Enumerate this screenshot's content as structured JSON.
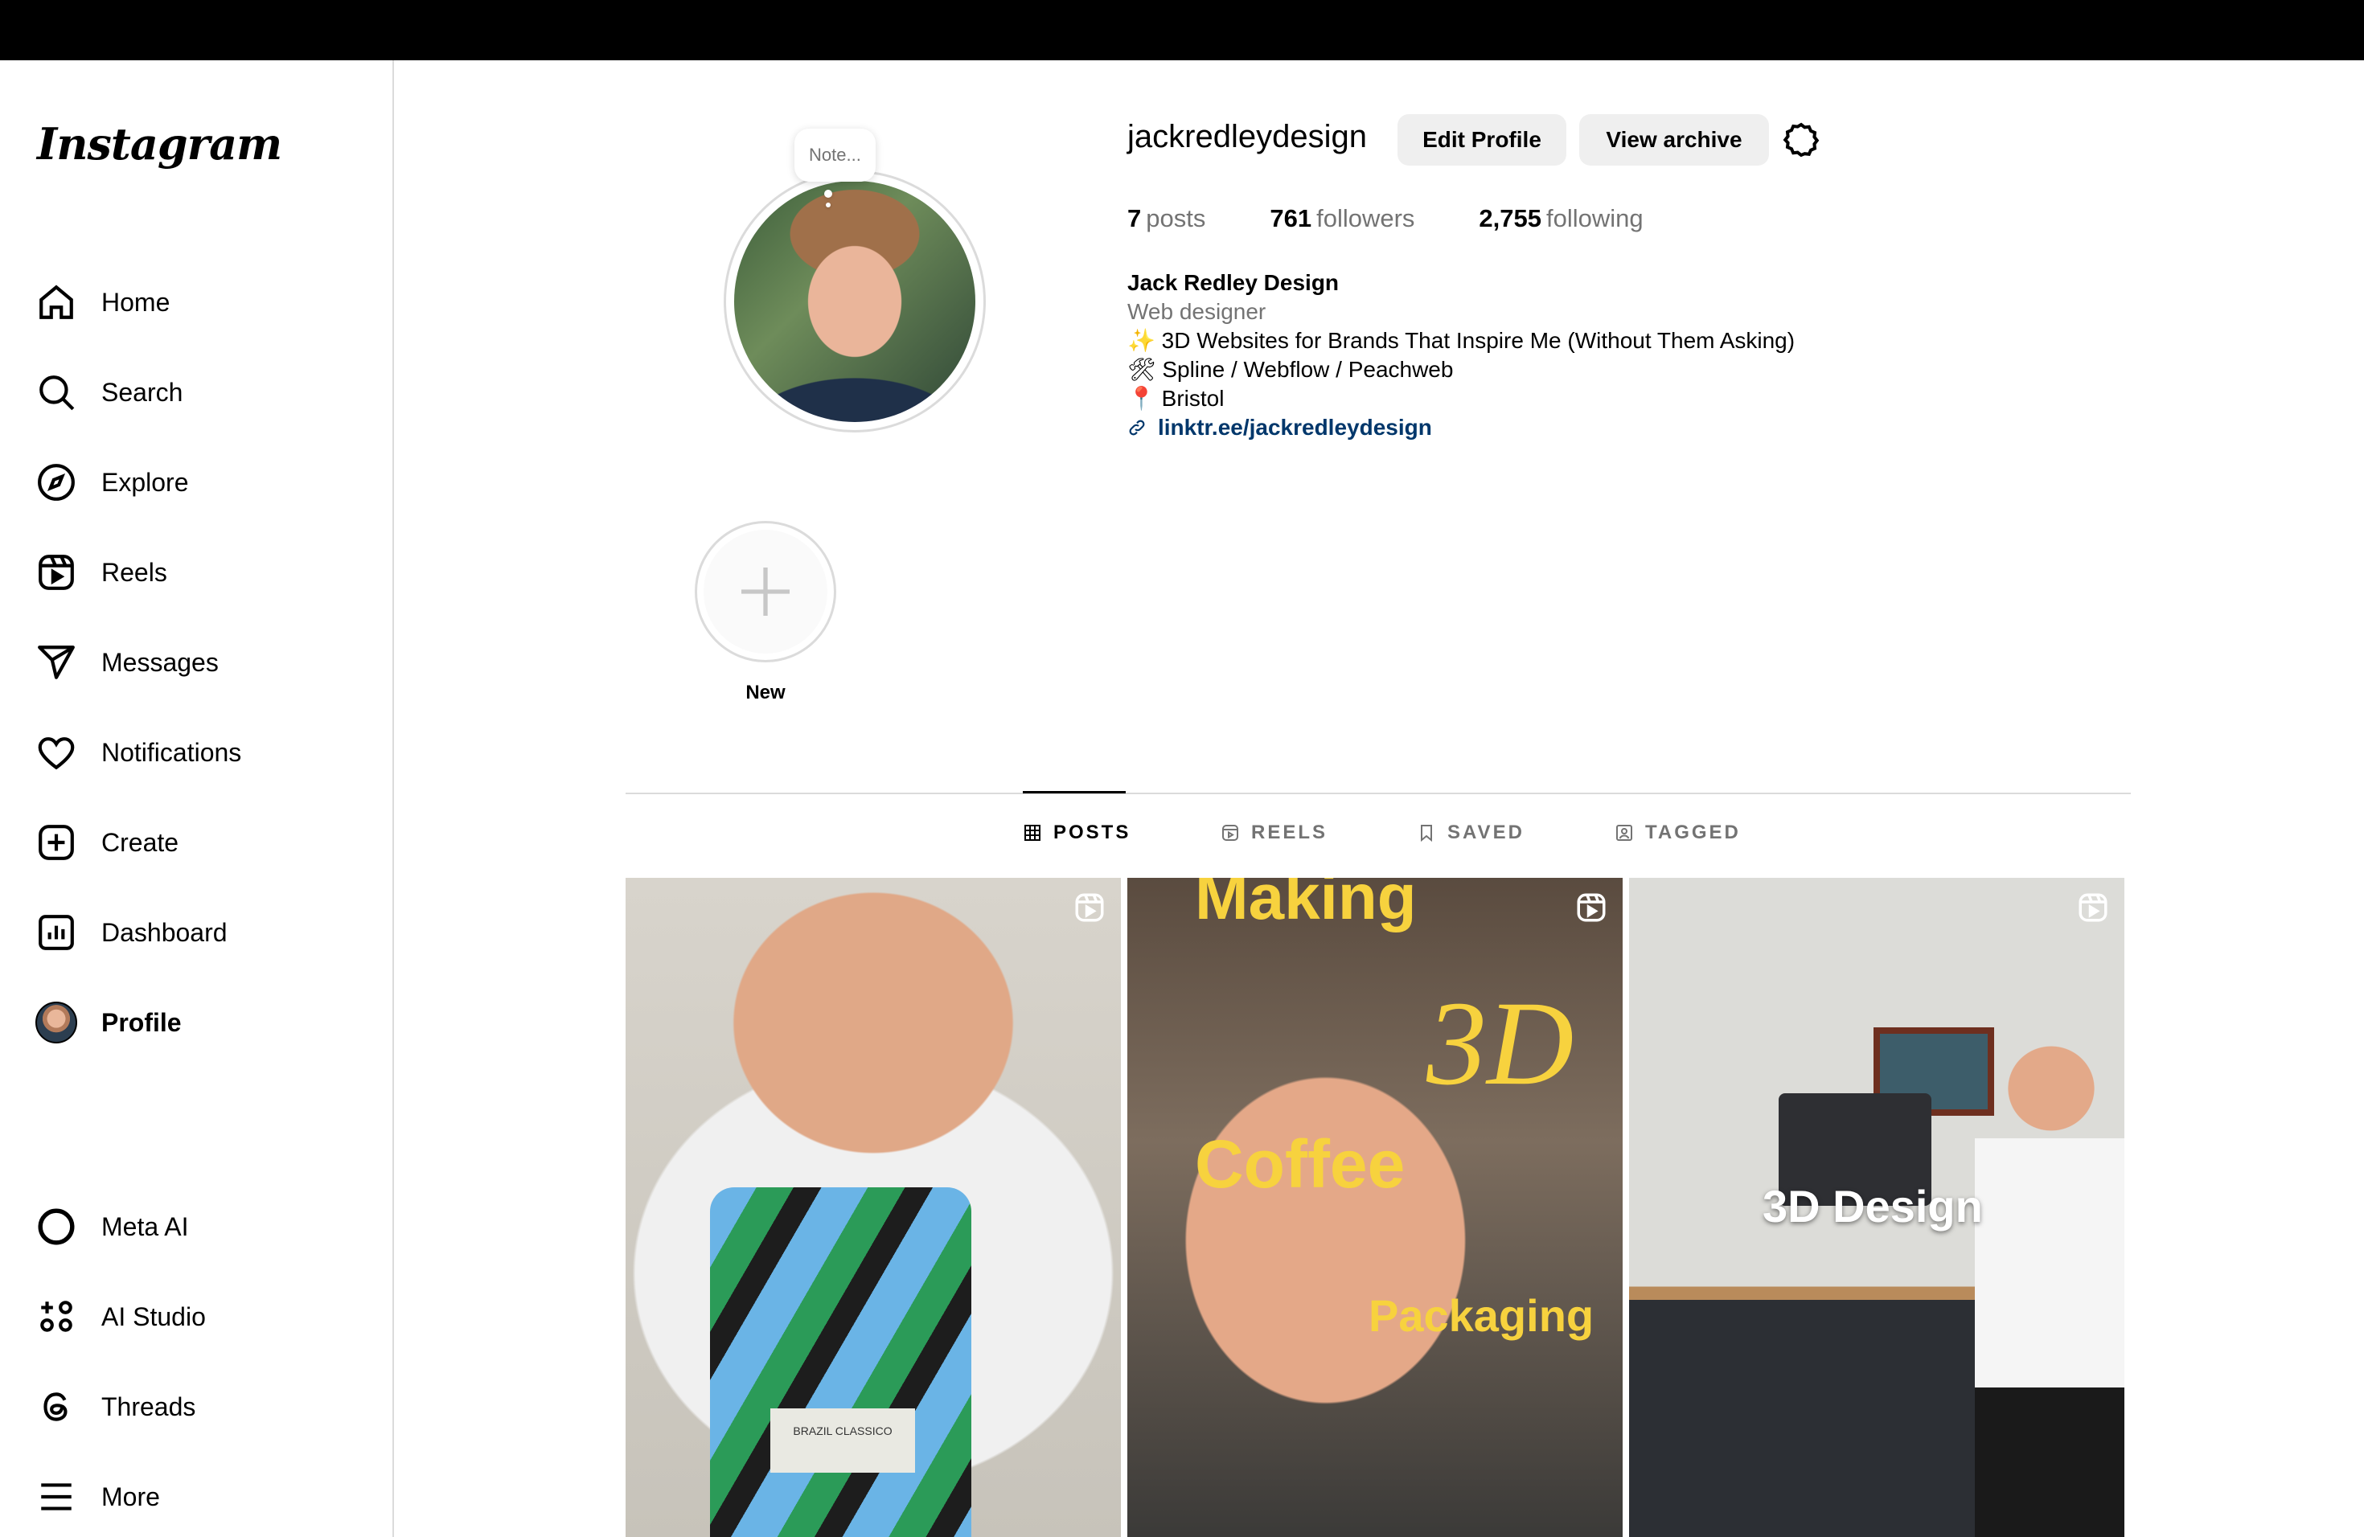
{
  "sidebar": {
    "logo": "Instagram",
    "items": [
      {
        "label": "Home",
        "icon": "home-icon"
      },
      {
        "label": "Search",
        "icon": "search-icon"
      },
      {
        "label": "Explore",
        "icon": "compass-icon"
      },
      {
        "label": "Reels",
        "icon": "reels-icon"
      },
      {
        "label": "Messages",
        "icon": "paper-plane-icon"
      },
      {
        "label": "Notifications",
        "icon": "heart-icon"
      },
      {
        "label": "Create",
        "icon": "plus-square-icon"
      },
      {
        "label": "Dashboard",
        "icon": "chart-icon"
      },
      {
        "label": "Profile",
        "icon": "avatar",
        "active": true
      }
    ],
    "bottom_items": [
      {
        "label": "Meta AI",
        "icon": "meta-ai-icon"
      },
      {
        "label": "AI Studio",
        "icon": "ai-studio-icon"
      },
      {
        "label": "Threads",
        "icon": "threads-icon"
      },
      {
        "label": "More",
        "icon": "menu-icon"
      }
    ]
  },
  "profile": {
    "note_placeholder": "Note...",
    "username": "jackredleydesign",
    "edit_button": "Edit Profile",
    "archive_button": "View archive",
    "stats": {
      "posts_count": "7",
      "posts_label": "posts",
      "followers_count": "761",
      "followers_label": "followers",
      "following_count": "2,755",
      "following_label": "following"
    },
    "bio": {
      "name": "Jack Redley Design",
      "category": "Web designer",
      "line1": "✨ 3D Websites for Brands That Inspire Me (Without Them Asking)",
      "line2": "🛠 Spline / Webflow / Peachweb",
      "line3": "📍 Bristol",
      "link": "linktr.ee/jackredleydesign"
    }
  },
  "highlights": [
    {
      "label": "New"
    }
  ],
  "tabs": [
    {
      "label": "POSTS",
      "active": true
    },
    {
      "label": "REELS"
    },
    {
      "label": "SAVED"
    },
    {
      "label": "TAGGED"
    }
  ],
  "posts": [
    {
      "type": "reel",
      "bag_text": "BRAZIL CLASSICO"
    },
    {
      "type": "reel",
      "text_making": "Making",
      "text_3d": "3D",
      "text_coffee": "Coffee",
      "text_packaging": "Packaging"
    },
    {
      "type": "reel",
      "text": "3D Design"
    }
  ],
  "colors": {
    "link": "#00376b",
    "accent_text": "#f7d23e",
    "secondary_text": "#737373",
    "button_bg": "#efefef"
  }
}
